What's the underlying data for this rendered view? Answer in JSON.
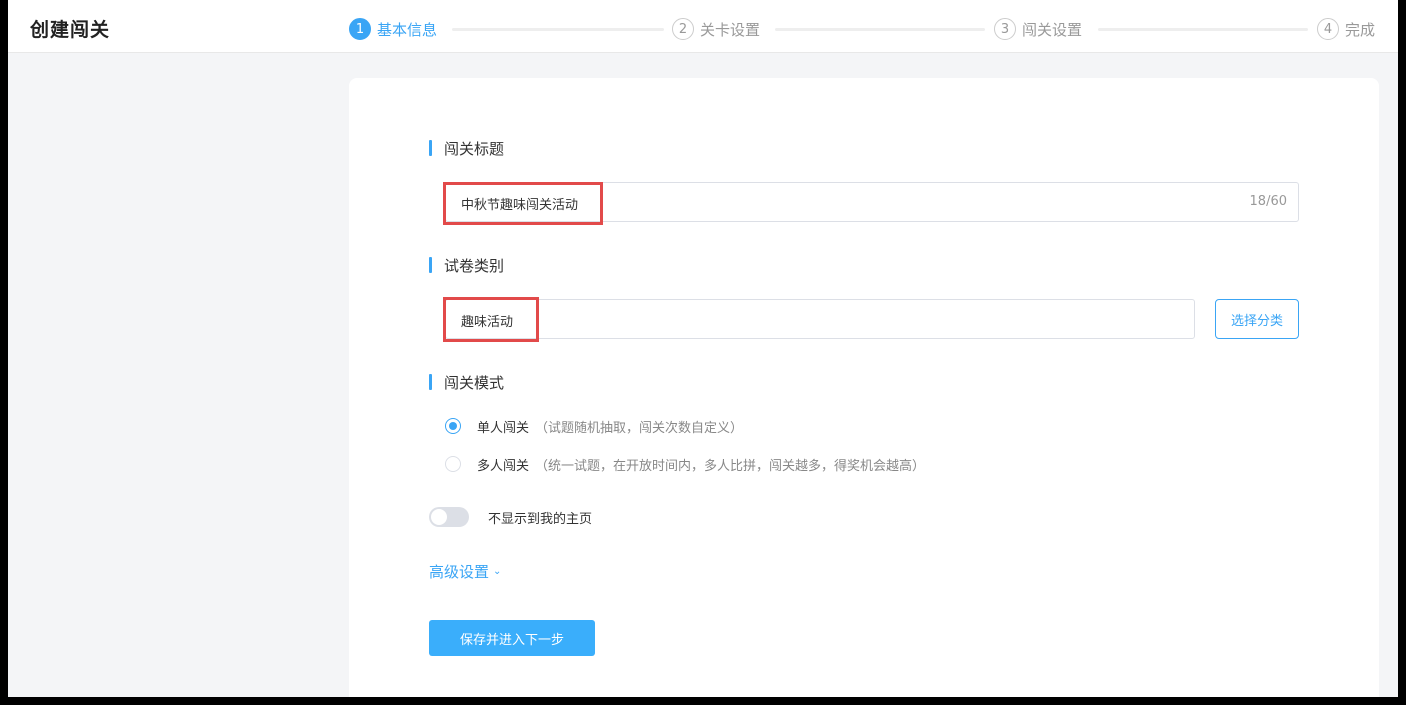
{
  "app": {
    "title": "创建闯关"
  },
  "steps": [
    {
      "num": "1",
      "label": "基本信息",
      "active": true
    },
    {
      "num": "2",
      "label": "关卡设置",
      "active": false
    },
    {
      "num": "3",
      "label": "闯关设置",
      "active": false
    },
    {
      "num": "4",
      "label": "完成",
      "active": false
    }
  ],
  "form": {
    "title_section": {
      "label": "闯关标题",
      "value": "中秋节趣味闯关活动",
      "count": "18/60"
    },
    "category_section": {
      "label": "试卷类别",
      "value": "趣味活动",
      "select_button": "选择分类"
    },
    "mode_section": {
      "label": "闯关模式",
      "options": [
        {
          "label": "单人闯关",
          "desc": "（试题随机抽取，闯关次数自定义）",
          "checked": true
        },
        {
          "label": "多人闯关",
          "desc": "（统一试题，在开放时间内，多人比拼，闯关越多，得奖机会越高）",
          "checked": false
        }
      ]
    },
    "toggle": {
      "label": "不显示到我的主页",
      "on": false
    },
    "advanced_label": "高级设置",
    "submit_label": "保存并进入下一步"
  },
  "colors": {
    "accent": "#3aa5f5",
    "highlight": "#e24a4a",
    "background": "#f4f5f7"
  },
  "icons": {
    "advanced_toggle": "chevron-down-icon"
  }
}
